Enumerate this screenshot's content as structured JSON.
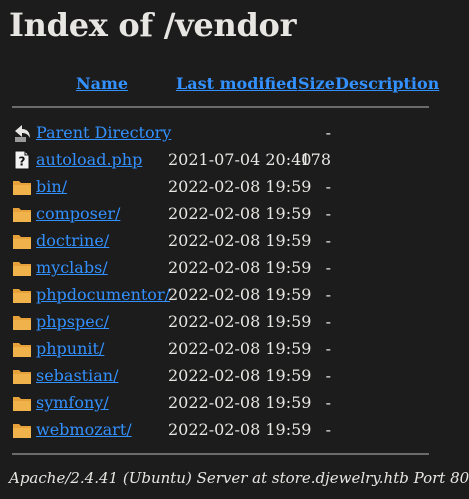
{
  "title": "Index of /vendor",
  "columns": {
    "name": "Name",
    "last_modified": "Last modified",
    "size": "Size",
    "description": "Description"
  },
  "entries": [
    {
      "name": "Parent Directory",
      "modified": "",
      "size": "-",
      "icon": "back-icon"
    },
    {
      "name": "autoload.php",
      "modified": "2021-07-04 20:40",
      "size": "178",
      "icon": "unknown-file-icon"
    },
    {
      "name": "bin/",
      "modified": "2022-02-08 19:59",
      "size": "-",
      "icon": "folder-icon"
    },
    {
      "name": "composer/",
      "modified": "2022-02-08 19:59",
      "size": "-",
      "icon": "folder-icon"
    },
    {
      "name": "doctrine/",
      "modified": "2022-02-08 19:59",
      "size": "-",
      "icon": "folder-icon"
    },
    {
      "name": "myclabs/",
      "modified": "2022-02-08 19:59",
      "size": "-",
      "icon": "folder-icon"
    },
    {
      "name": "phpdocumentor/",
      "modified": "2022-02-08 19:59",
      "size": "-",
      "icon": "folder-icon"
    },
    {
      "name": "phpspec/",
      "modified": "2022-02-08 19:59",
      "size": "-",
      "icon": "folder-icon"
    },
    {
      "name": "phpunit/",
      "modified": "2022-02-08 19:59",
      "size": "-",
      "icon": "folder-icon"
    },
    {
      "name": "sebastian/",
      "modified": "2022-02-08 19:59",
      "size": "-",
      "icon": "folder-icon"
    },
    {
      "name": "symfony/",
      "modified": "2022-02-08 19:59",
      "size": "-",
      "icon": "folder-icon"
    },
    {
      "name": "webmozart/",
      "modified": "2022-02-08 19:59",
      "size": "-",
      "icon": "folder-icon"
    }
  ],
  "footer": "Apache/2.4.41 (Ubuntu) Server at store.djewelry.htb Port 80",
  "colors": {
    "background": "#1c1c1c",
    "text": "#e8e6e3",
    "link": "#3391ff",
    "folder": "#e6a13a",
    "rule": "#6b6b6b"
  }
}
